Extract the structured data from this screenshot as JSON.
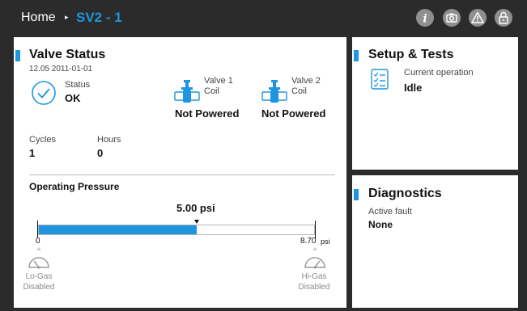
{
  "header": {
    "home_label": "Home",
    "separator": "▸",
    "current_label": "SV2 - 1",
    "icons": [
      "info-icon",
      "camera-icon",
      "warning-icon",
      "lock-icon"
    ]
  },
  "valve_status": {
    "title": "Valve Status",
    "date": "12.05 2011-01-01",
    "status_label": "Status",
    "status_value": "OK",
    "valve1_label_line1": "Valve 1",
    "valve1_label_line2": "Coil",
    "valve1_value": "Not Powered",
    "valve2_label_line1": "Valve 2",
    "valve2_label_line2": "Coil",
    "valve2_value": "Not Powered",
    "cycles_label": "Cycles",
    "cycles_value": "1",
    "hours_label": "Hours",
    "hours_value": "0"
  },
  "pressure": {
    "title": "Operating Pressure",
    "current_label": "5.00 psi",
    "current_value": 5.0,
    "min_label": "0",
    "max_label": "8.70",
    "max_unit": "psi",
    "max_value": 8.7,
    "fill_color": "#1f95e0",
    "lo_gas_line1": "Lo-Gas",
    "lo_gas_line2": "Disabled",
    "hi_gas_line1": "Hi-Gas",
    "hi_gas_line2": "Disabled"
  },
  "setup": {
    "title": "Setup & Tests",
    "op_label": "Current operation",
    "op_value": "Idle"
  },
  "diagnostics": {
    "title": "Diagnostics",
    "fault_label": "Active fault",
    "fault_value": "None"
  }
}
